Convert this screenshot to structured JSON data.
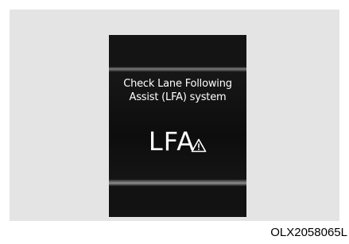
{
  "cluster_message": {
    "line1": "Check Lane Following",
    "line2": "Assist (LFA) system"
  },
  "indicator": {
    "text": "LFA",
    "icon": "warning-triangle-icon",
    "color": "#ffffff"
  },
  "figure_code": "OLX2058065L"
}
